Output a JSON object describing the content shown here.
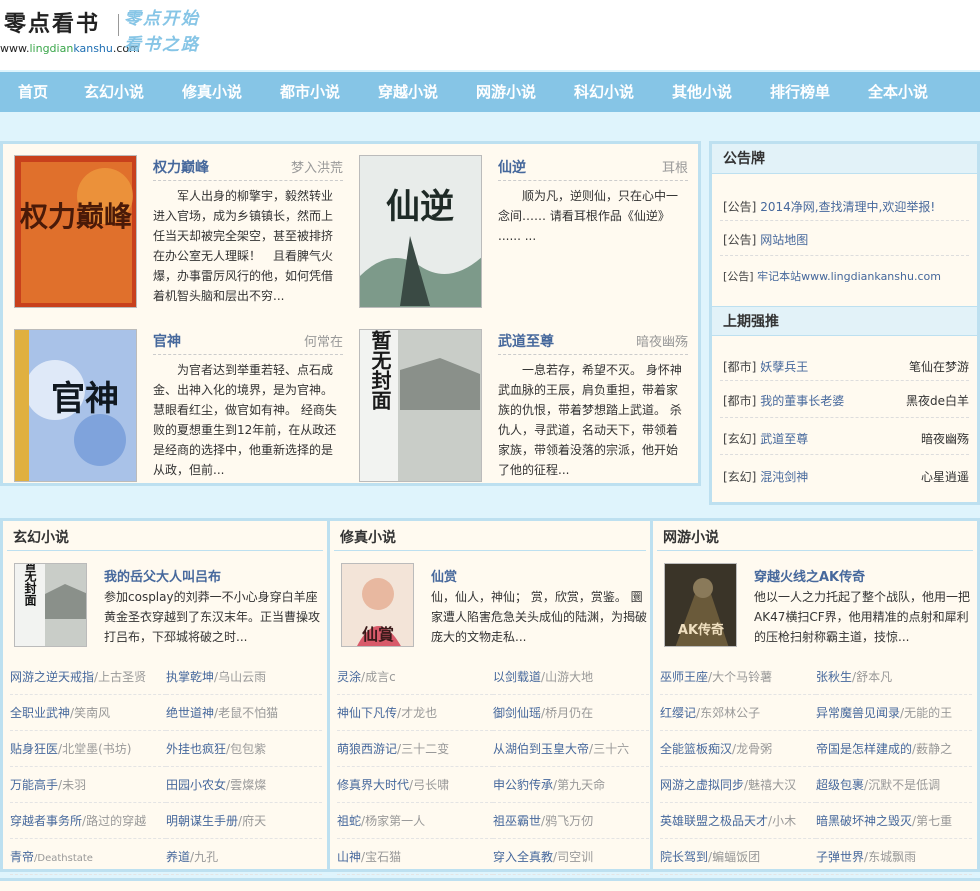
{
  "site": {
    "logo_text": "零点看书",
    "url_prefix": "www.",
    "url_green": "lingdian",
    "url_blue": "kanshu",
    "url_suffix": ".com",
    "slogan_1": "零点开始",
    "slogan_2": "看书之路"
  },
  "nav": [
    "首页",
    "玄幻小说",
    "修真小说",
    "都市小说",
    "穿越小说",
    "网游小说",
    "科幻小说",
    "其他小说",
    "排行榜单",
    "全本小说"
  ],
  "featured": [
    {
      "title": "权力巅峰",
      "author": "梦入洪荒",
      "desc": "军人出身的柳擎宇，毅然转业进入官场，成为乡镇镇长，然而上任当天却被完全架空，甚至被排挤在办公室无人理睬！　且看脾气火爆，办事雷厉风行的他，如何凭借着机智头脑和层出不穷...",
      "cover": "权力巅峰"
    },
    {
      "title": "仙逆",
      "author": "耳根",
      "desc": "顺为凡，逆则仙，只在心中一念间…… 请看耳根作品《仙逆》 ...... ...",
      "cover": "仙逆"
    },
    {
      "title": "官神",
      "author": "何常在",
      "desc": "为官者达到举重若轻、点石成金、出神入化的境界，是为官神。慧眼看红尘，做官如有神。 经商失败的夏想重生到12年前，在从政还是经商的选择中，他重新选择的是从政，但前...",
      "cover": "官神"
    },
    {
      "title": "武道至尊",
      "author": "暗夜幽殇",
      "desc": "一息若存，希望不灭。 身怀神武血脉的王辰，肩负重担，带着家族的仇恨，带着梦想踏上武道。 杀仇人，寻武道，名动天下，带领着家族，带领着没落的宗派，他开始了他的征程...",
      "cover": "暂无封面"
    }
  ],
  "notice": {
    "header": "公告牌",
    "items": [
      {
        "tag": "[公告]",
        "text": "2014净网,查找清理中,欢迎举报!"
      },
      {
        "tag": "[公告]",
        "text": "网站地图"
      },
      {
        "tag": "[公告]",
        "text": "牢记本站www.lingdiankanshu.com"
      }
    ]
  },
  "top": {
    "header": "上期强推",
    "items": [
      {
        "tag": "[都市]",
        "book": "妖孽兵王",
        "author": "笔仙在梦游"
      },
      {
        "tag": "[都市]",
        "book": "我的董事长老婆",
        "author": "黑夜de白羊"
      },
      {
        "tag": "[玄幻]",
        "book": "武道至尊",
        "author": "暗夜幽殇"
      },
      {
        "tag": "[玄幻]",
        "book": "混沌剑神",
        "author": "心星逍遥"
      }
    ]
  },
  "categories": [
    {
      "header": "玄幻小说",
      "title": "我的岳父大人叫吕布",
      "desc": "参加cosplay的刘莽一不小心身穿白羊座黄金圣衣穿越到了东汉末年。正当曹操攻打吕布，下邳城将破之时...",
      "cover": "暂无封面",
      "list": [
        {
          "book": "网游之逆天戒指",
          "author": "上古圣贤"
        },
        {
          "book": "执掌乾坤",
          "author": "乌山云雨"
        },
        {
          "book": "全职业武神",
          "author": "笑南风"
        },
        {
          "book": "绝世道神",
          "author": "老鼠不怕猫"
        },
        {
          "book": "贴身狂医",
          "author": "北堂墨(书坊)"
        },
        {
          "book": "外挂也疯狂",
          "author": "包包紫"
        },
        {
          "book": "万能高手",
          "author": "未羽"
        },
        {
          "book": "田园小农女",
          "author": "雲燦燦"
        },
        {
          "book": "穿越者事务所",
          "author": "路过的穿越"
        },
        {
          "book": "明朝谋生手册",
          "author": "府天"
        },
        {
          "book": "青帝",
          "author": "Deathstate"
        },
        {
          "book": "养道",
          "author": "九孔"
        }
      ]
    },
    {
      "header": "修真小说",
      "title": "仙赏",
      "desc": "仙，仙人，神仙； 赏，欣赏，赏鉴。 圜家遭人陷害危急关头成仙的陆渊，为揭破庞大的文物走私...",
      "cover": "仙賞",
      "list": [
        {
          "book": "灵涂",
          "author": "成言c"
        },
        {
          "book": "以剑载道",
          "author": "山游大地"
        },
        {
          "book": "神仙下凡传",
          "author": "才龙也"
        },
        {
          "book": "御剑仙瑶",
          "author": "桥月仍在"
        },
        {
          "book": "萌狼西游记",
          "author": "三十二变"
        },
        {
          "book": "从湖伯到玉皇大帝",
          "author": "三十六"
        },
        {
          "book": "修真界大时代",
          "author": "弓长啸"
        },
        {
          "book": "申公豹传承",
          "author": "第九天命"
        },
        {
          "book": "祖蛇",
          "author": "杨家第一人"
        },
        {
          "book": "祖巫霸世",
          "author": "鸦飞万仞"
        },
        {
          "book": "山神",
          "author": "宝石猫"
        },
        {
          "book": "穿入全真教",
          "author": "司空训"
        }
      ]
    },
    {
      "header": "网游小说",
      "title": "穿越火线之AK传奇",
      "desc": "他以一人之力托起了整个战队，他用一把AK47横扫CF界，他用精准的点射和犀利的压枪扫射称霸主道，技惊...",
      "cover": "AK传奇",
      "list": [
        {
          "book": "巫师王座",
          "author": "大个马铃薯"
        },
        {
          "book": "张秋生",
          "author": "舒本凡"
        },
        {
          "book": "红缨记",
          "author": "东郊林公子"
        },
        {
          "book": "异常魔兽见闻录",
          "author": "无能的王"
        },
        {
          "book": "全能篮板痴汉",
          "author": "龙骨粥"
        },
        {
          "book": "帝国是怎样建成的",
          "author": "薮静之"
        },
        {
          "book": "网游之虚拟同步",
          "author": "魅禧大汉"
        },
        {
          "book": "超级包裹",
          "author": "沉默不是低调"
        },
        {
          "book": "英雄联盟之极品天才",
          "author": "小木"
        },
        {
          "book": "暗黑破坏神之毁灭",
          "author": "第七重"
        },
        {
          "book": "院长驾到",
          "author": "蝙蝠饭团"
        },
        {
          "book": "子弹世界",
          "author": "东城飘雨"
        }
      ]
    }
  ]
}
